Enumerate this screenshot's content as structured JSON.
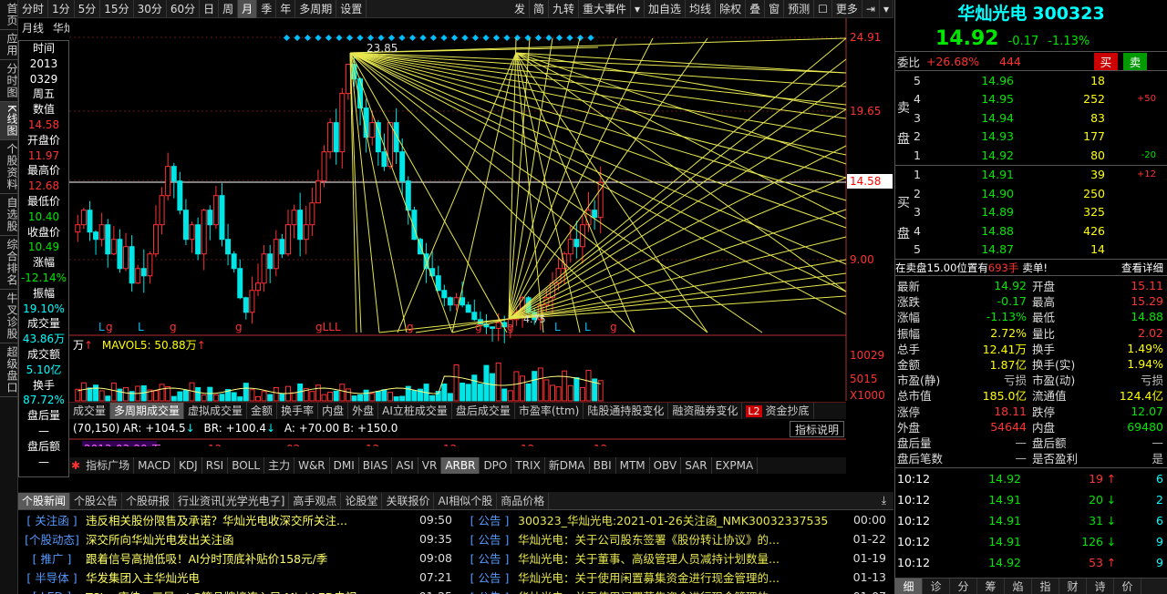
{
  "sidebar": [
    {
      "label": "首页",
      "active": false
    },
    {
      "label": "应用",
      "active": false
    },
    {
      "label": "分时图",
      "active": false
    },
    {
      "label": "K线图",
      "active": true
    },
    {
      "label": "个股资料",
      "active": false
    },
    {
      "label": "自选股",
      "active": false
    },
    {
      "label": "综合排名",
      "active": false
    },
    {
      "label": "牛叉诊股",
      "active": false
    },
    {
      "label": "超级盘口",
      "active": false
    }
  ],
  "toolbar": {
    "periods": [
      "分时",
      "1分",
      "5分",
      "15分",
      "30分",
      "60分",
      "日",
      "周",
      "月",
      "季",
      "年",
      "多周期",
      "设置"
    ],
    "active": "月",
    "right": [
      "发",
      "简",
      "九转",
      "重大事件",
      "▾",
      "加自选",
      "均线",
      "除权",
      "叠",
      "窗",
      "预测",
      "☐",
      "更多",
      "⇥",
      "▾"
    ]
  },
  "chart": {
    "period_label": "月线",
    "stock_name": "华灿光电",
    "high_label": "23.85",
    "low_label": "4.75",
    "price_levels": [
      "24.91",
      "19.65",
      "14.58",
      "9.00"
    ],
    "vol_levels": [
      "10029",
      "5015",
      "X1000"
    ],
    "current_tag": "14.58",
    "markers": [
      "L",
      "g",
      "L",
      "g",
      "g",
      "gLLL",
      "g",
      "g",
      "g",
      "L",
      "L",
      "g",
      "L"
    ],
    "dates": [
      "2013-03-29 五",
      "12",
      "02",
      "12",
      "12",
      "12",
      "12"
    ]
  },
  "info": [
    {
      "t": "时间",
      "c": "wht"
    },
    {
      "t": "2013",
      "c": "wht"
    },
    {
      "t": "0329",
      "c": "wht"
    },
    {
      "t": "周五",
      "c": "wht"
    },
    {
      "t": "数值",
      "c": "wht"
    },
    {
      "t": "14.58",
      "c": "red"
    },
    {
      "t": "开盘价",
      "c": "wht"
    },
    {
      "t": "11.97",
      "c": "red"
    },
    {
      "t": "最高价",
      "c": "wht"
    },
    {
      "t": "12.68",
      "c": "red"
    },
    {
      "t": "最低价",
      "c": "wht"
    },
    {
      "t": "10.40",
      "c": "green"
    },
    {
      "t": "收盘价",
      "c": "wht"
    },
    {
      "t": "10.49",
      "c": "green"
    },
    {
      "t": "涨幅",
      "c": "wht"
    },
    {
      "t": "-12.14%",
      "c": "green"
    },
    {
      "t": "振幅",
      "c": "wht"
    },
    {
      "t": "19.10%",
      "c": "cyan"
    },
    {
      "t": "成交量",
      "c": "wht"
    },
    {
      "t": "43.86万",
      "c": "cyan"
    },
    {
      "t": "成交额",
      "c": "wht"
    },
    {
      "t": "5.10亿",
      "c": "cyan"
    },
    {
      "t": "换手",
      "c": "wht"
    },
    {
      "t": "87.72%",
      "c": "cyan"
    },
    {
      "t": "盘后量",
      "c": "wht"
    },
    {
      "t": "—",
      "c": "wht"
    },
    {
      "t": "盘后额",
      "c": "wht"
    },
    {
      "t": "—",
      "c": "wht"
    }
  ],
  "vol_header": {
    "a": "万",
    "b": "MAVOL5: 50.88万"
  },
  "vol_tabs": [
    "成交量",
    "多周期成交量",
    "虚拟成交量",
    "金额",
    "换手率",
    "内盘",
    "外盘",
    "AI立桩成交量",
    "盘后成交量",
    "市盈率(ttm)",
    "陆股通持股变化",
    "融资融券变化",
    "资金抄底"
  ],
  "vol_tab_active": "多周期成交量",
  "badge": "L2",
  "indicator_text": "(70,150) AR: +104.5",
  "indicator_text2": "BR: +100.4",
  "indicator_text3": "A: +70.00 B: +150.0",
  "indicator_help": "指标说明",
  "ind_tabs": [
    "指标广场",
    "MACD",
    "KDJ",
    "RSI",
    "BOLL",
    "主力",
    "W&R",
    "DMI",
    "BIAS",
    "ASI",
    "VR",
    "ARBR",
    "DPO",
    "TRIX",
    "新DMA",
    "BBI",
    "MTM",
    "OBV",
    "SAR",
    "EXPMA"
  ],
  "ind_tab_active": "ARBR",
  "news_tabs": [
    "个股新闻",
    "个股公告",
    "个股研报",
    "行业资讯[光学光电子]",
    "高手观点",
    "论股堂",
    "关联报价",
    "AI相似个股",
    "商品价格"
  ],
  "news_left": [
    {
      "tag": "[ 关注函 ]",
      "title": "违反相关股份限售及承诺？华灿光电收深交所关注...",
      "time": "09:50"
    },
    {
      "tag": "[个股动态]",
      "title": "深交所向华灿光电发出关注函",
      "time": "09:35"
    },
    {
      "tag": "[ 推广 ]",
      "title": "跟着信号高抛低吸！AI分时顶底补贴价158元/季",
      "time": "09:08"
    },
    {
      "tag": "[ 半导体 ]",
      "title": "华发集团入主华灿光电",
      "time": "07:21"
    },
    {
      "tag": "[ LED ]",
      "title": "TCL、康佳、三星、LG等品牌接连入局 Mini LED电视...",
      "time": "01-25"
    }
  ],
  "news_right": [
    {
      "tag": "[ 公告 ]",
      "title": "300323_华灿光电:2021-01-26关注函_NMK30032337535",
      "time": "00:00"
    },
    {
      "tag": "[ 公告 ]",
      "title": "华灿光电：关于公司股东签署《股份转让协议》的...",
      "time": "01-22"
    },
    {
      "tag": "[ 公告 ]",
      "title": "华灿光电：关于董事、高级管理人员减持计划数量...",
      "time": "01-19"
    },
    {
      "tag": "[ 公告 ]",
      "title": "华灿光电：关于使用闲置募集资金进行现金管理的...",
      "time": "01-13"
    },
    {
      "tag": "[ 公告 ]",
      "title": "华灿光电：关于使用闲置募集资金进行现金管理的...",
      "time": "01-07"
    }
  ],
  "quote": {
    "name": "华灿光电",
    "code": "300323",
    "price": "14.92",
    "change": "-0.17",
    "pct": "-1.13%",
    "weibi_label": "委比",
    "weibi": "+26.68%",
    "weicha": "444",
    "buy_btn": "买",
    "sell_btn": "卖",
    "sell": [
      {
        "n": "5",
        "p": "14.96",
        "v": "18",
        "d": ""
      },
      {
        "n": "4",
        "p": "14.95",
        "v": "252",
        "d": "+50"
      },
      {
        "n": "3",
        "p": "14.94",
        "v": "83",
        "d": ""
      },
      {
        "n": "2",
        "p": "14.93",
        "v": "177",
        "d": ""
      },
      {
        "n": "1",
        "p": "14.92",
        "v": "80",
        "d": "-20"
      }
    ],
    "buy": [
      {
        "n": "1",
        "p": "14.91",
        "v": "39",
        "d": "+12"
      },
      {
        "n": "2",
        "p": "14.90",
        "v": "250",
        "d": ""
      },
      {
        "n": "3",
        "p": "14.89",
        "v": "325",
        "d": ""
      },
      {
        "n": "4",
        "p": "14.88",
        "v": "426",
        "d": ""
      },
      {
        "n": "5",
        "p": "14.87",
        "v": "14",
        "d": ""
      }
    ],
    "sell_label": [
      "卖",
      "盘"
    ],
    "buy_label": [
      "买",
      "盘"
    ],
    "notice_a": "在卖盘15.00位置有",
    "notice_b": "693手",
    "notice_c": "卖单!",
    "notice_link": "查看详细"
  },
  "fund": [
    {
      "l": "最新",
      "v": "14.92",
      "c": "green",
      "l2": "开盘",
      "v2": "15.11",
      "c2": "red"
    },
    {
      "l": "涨跌",
      "v": "-0.17",
      "c": "green",
      "l2": "最高",
      "v2": "15.29",
      "c2": "red"
    },
    {
      "l": "涨幅",
      "v": "-1.13%",
      "c": "green",
      "l2": "最低",
      "v2": "14.88",
      "c2": "green"
    },
    {
      "l": "振幅",
      "v": "2.72%",
      "c": "yel",
      "l2": "量比",
      "v2": "2.02",
      "c2": "red"
    },
    {
      "l": "总手",
      "v": "12.41万",
      "c": "yel",
      "l2": "换手",
      "v2": "1.49%",
      "c2": "yel"
    },
    {
      "l": "金额",
      "v": "1.87亿",
      "c": "yel",
      "l2": "换手(实)",
      "v2": "1.94%",
      "c2": "yel"
    },
    {
      "l": "市盈(静)",
      "v": "亏损",
      "c": "gray",
      "l2": "市盈(动)",
      "v2": "亏损",
      "c2": "gray"
    },
    {
      "l": "总市值",
      "v": "185.0亿",
      "c": "yel",
      "l2": "流通值",
      "v2": "124.4亿",
      "c2": "yel"
    },
    {
      "l": "涨停",
      "v": "18.11",
      "c": "red",
      "l2": "跌停",
      "v2": "12.07",
      "c2": "green"
    },
    {
      "l": "外盘",
      "v": "54644",
      "c": "red",
      "l2": "内盘",
      "v2": "69480",
      "c2": "green"
    },
    {
      "l": "盘后量",
      "v": "—",
      "c": "gray",
      "l2": "盘后额",
      "v2": "—",
      "c2": "gray"
    },
    {
      "l": "盘后笔数",
      "v": "—",
      "c": "gray",
      "l2": "是否盈利",
      "v2": "是",
      "c2": "gray"
    }
  ],
  "ticks": [
    {
      "t": "10:12",
      "p": "14.92",
      "v": "19",
      "d": "up",
      "n": "6"
    },
    {
      "t": "10:12",
      "p": "14.91",
      "v": "20",
      "d": "down",
      "n": "2"
    },
    {
      "t": "10:12",
      "p": "14.91",
      "v": "31",
      "d": "down",
      "n": "6"
    },
    {
      "t": "10:12",
      "p": "14.91",
      "v": "126",
      "d": "down",
      "n": "9"
    },
    {
      "t": "10:12",
      "p": "14.92",
      "v": "53",
      "d": "up",
      "n": "9"
    }
  ],
  "bottom_tabs": [
    "细",
    "诊",
    "分",
    "筹",
    "焰",
    "指",
    "财",
    "诗",
    "价"
  ],
  "bottom_active": "细"
}
